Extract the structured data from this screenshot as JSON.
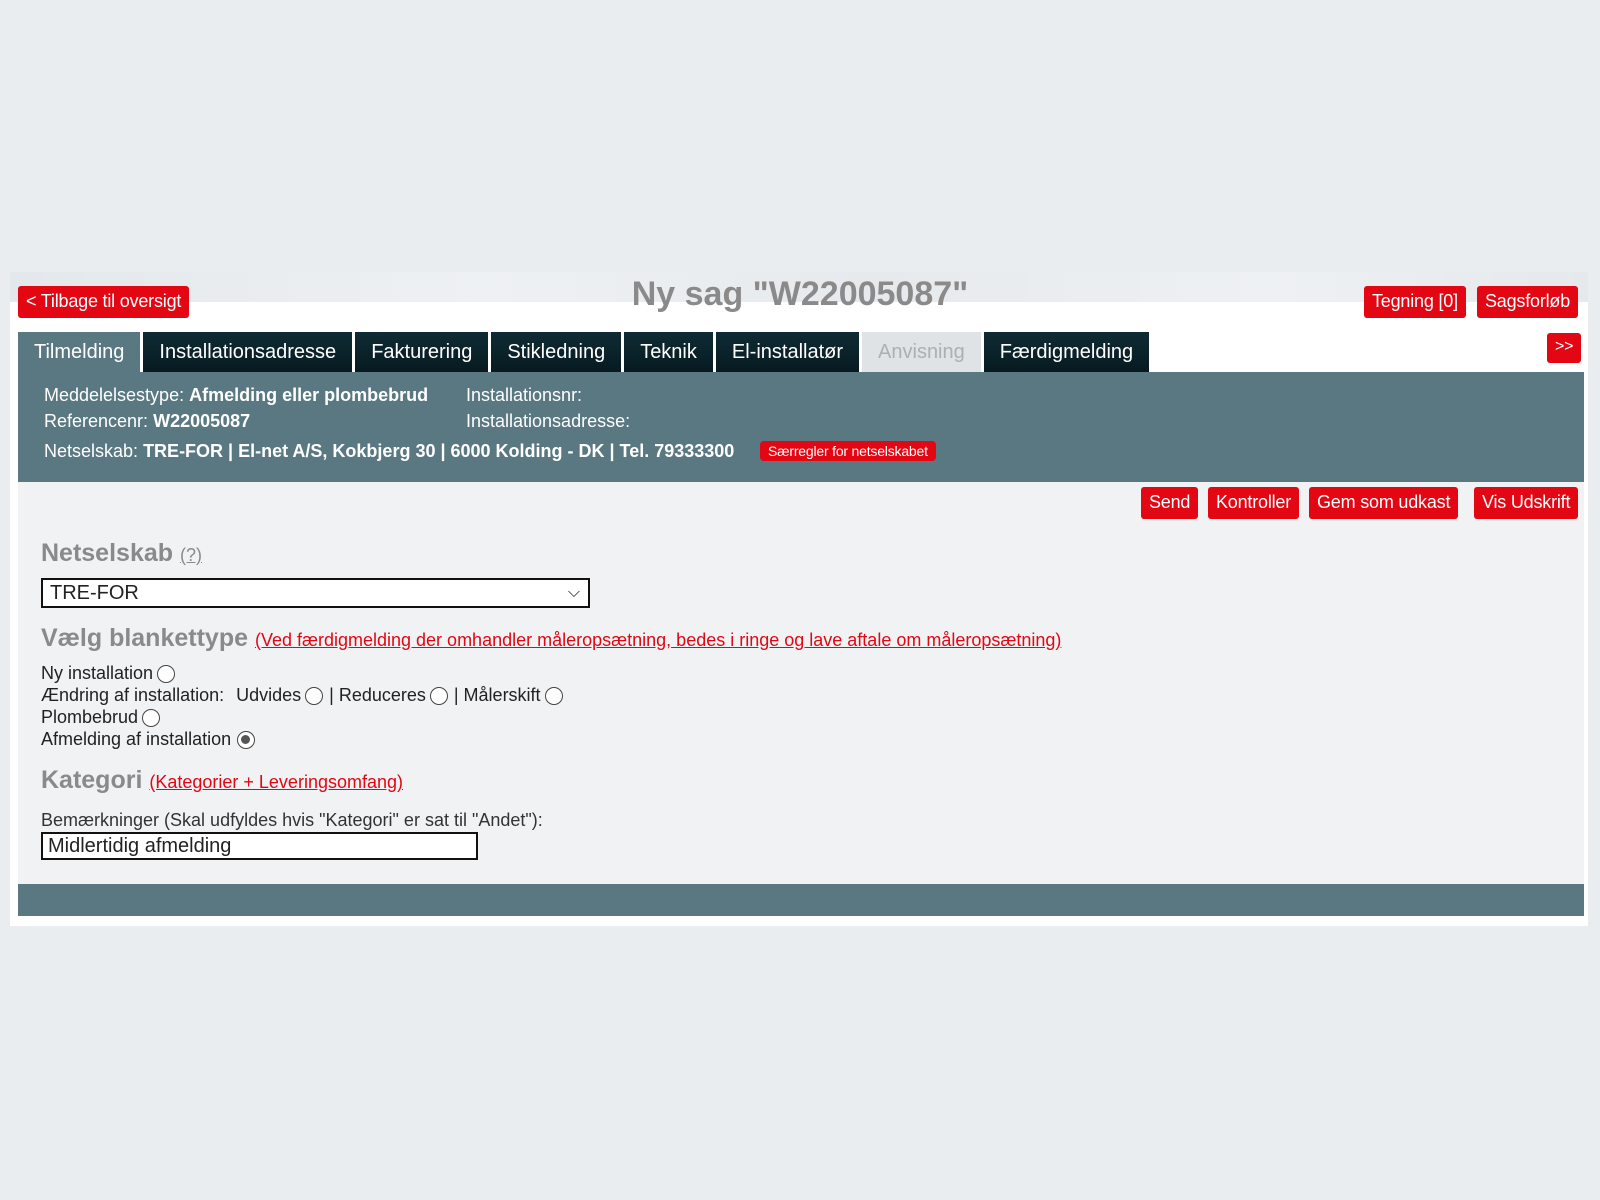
{
  "header": {
    "back_label": "< Tilbage til oversigt",
    "title": "Ny sag \"W22005087\"",
    "drawing_label": "Tegning [0]",
    "history_label": "Sagsforløb",
    "more_label": ">>"
  },
  "tabs": [
    {
      "label": "Tilmelding"
    },
    {
      "label": "Installationsadresse"
    },
    {
      "label": "Fakturering"
    },
    {
      "label": "Stikledning"
    },
    {
      "label": "Teknik"
    },
    {
      "label": "El-installatør"
    },
    {
      "label": "Anvisning"
    },
    {
      "label": "Færdigmelding"
    }
  ],
  "info": {
    "messagetype_label": "Meddelelsestype:",
    "messagetype_value": "Afmelding eller plombebrud",
    "installnr_label": "Installationsnr:",
    "refnr_label": "Referencenr:",
    "refnr_value": "W22005087",
    "installaddr_label": "Installationsadresse:",
    "netcompany_label": "Netselskab:",
    "netcompany_value": "TRE-FOR | El-net A/S, Kokbjerg 30 | 6000 Kolding - DK | Tel. 79333300",
    "special_rules_label": "Særregler for netselskabet"
  },
  "actions": {
    "send": "Send",
    "check": "Kontroller",
    "save_draft": "Gem som udkast",
    "print": "Vis Udskrift"
  },
  "form": {
    "netcompany_title": "Netselskab",
    "netcompany_help": "(?)",
    "netcompany_selected": "TRE-FOR",
    "blank_title": "Vælg blankettype",
    "blank_hint": "(Ved færdigmelding der omhandler måleropsætning, bedes i ringe og lave aftale om måleropsætning)",
    "opt_new": "Ny installation",
    "opt_change": "Ændring af installation:",
    "opt_expand": "Udvides",
    "opt_reduce": "| Reduceres",
    "opt_meter": "| Målerskift",
    "opt_seal": "Plombebrud",
    "opt_cancel": "Afmelding af installation",
    "category_title": "Kategori",
    "category_hint": "(Kategorier + Leveringsomfang)",
    "remarks_label": "Bemærkninger (Skal udfyldes hvis \"Kategori\" er sat til \"Andet\"):",
    "remarks_value": "Midlertidig afmelding"
  },
  "colors": {
    "accent_red": "#e30613",
    "bar_teal": "#5a7882",
    "tab_dark": "#0f2b35"
  }
}
